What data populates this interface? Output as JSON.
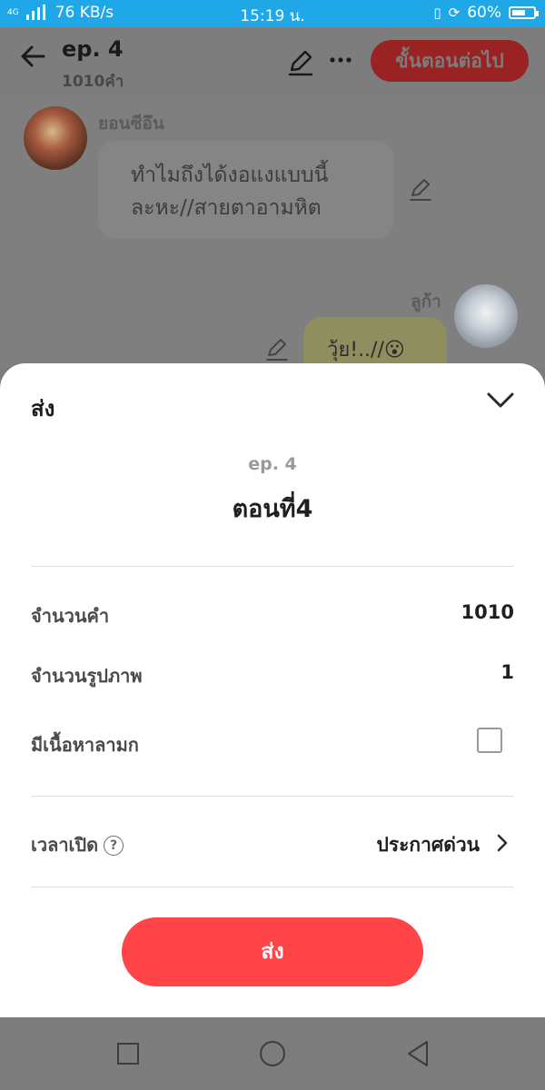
{
  "status_bar": {
    "network_type": "4G",
    "speed": "76 KB/s",
    "time": "15:19 น.",
    "battery": "60%",
    "battery_level": 0.6
  },
  "header": {
    "title": "ep. 4",
    "subtitle": "1010คำ",
    "next_button": "ขั้นตอนต่อไป"
  },
  "chat": {
    "messages": [
      {
        "sender": "ยอนซีอึน",
        "text_line1": "ทำไมถึงได้งอแงแบบนี้",
        "text_line2": "ละหะ//สายตาอามหิต"
      },
      {
        "sender": "ลูก้า",
        "text": "วุ้ย!..//😮"
      }
    ]
  },
  "sheet": {
    "title": "ส่ง",
    "episode": "ep. 4",
    "episode_name": "ตอนที่4",
    "word_count_label": "จำนวนคำ",
    "word_count_value": "1010",
    "image_count_label": "จำนวนรูปภาพ",
    "image_count_value": "1",
    "mature_label": "มีเนื้อหาลามก",
    "mature_checked": false,
    "open_time_label": "เวลาเปิด",
    "help_icon_glyph": "?",
    "open_time_value": "ประกาศด่วน",
    "send_button": "ส่ง"
  },
  "colors": {
    "status_bar": "#1fa7e8",
    "accent": "#ff4547",
    "overlay": "#7d7d7d"
  }
}
